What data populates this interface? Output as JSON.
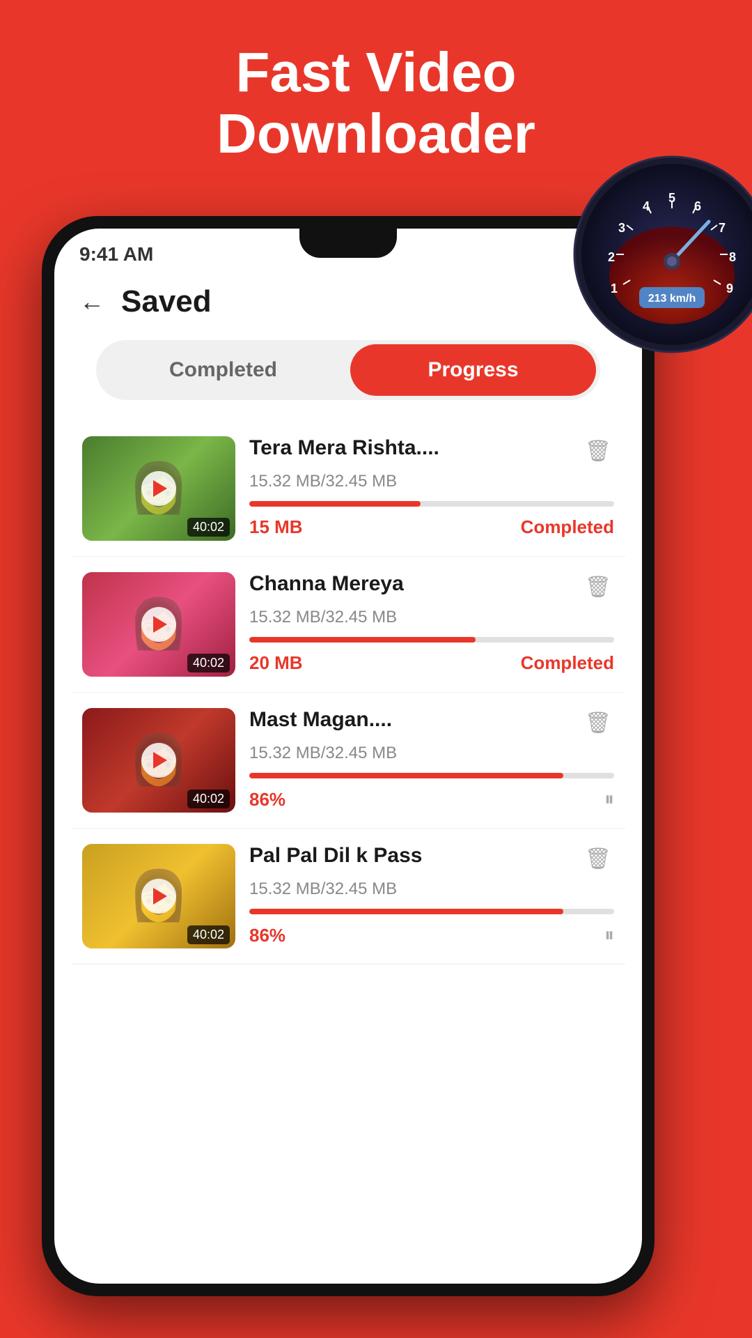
{
  "hero": {
    "title_line1": "Fast Video",
    "title_line2": "Downloader"
  },
  "status_bar": {
    "time": "9:41 AM"
  },
  "header": {
    "title": "Saved"
  },
  "tabs": [
    {
      "id": "completed",
      "label": "Completed",
      "active": false
    },
    {
      "id": "progress",
      "label": "Progress",
      "active": true
    }
  ],
  "videos": [
    {
      "id": 1,
      "title": "Tera Mera Rishta....",
      "size_info": "15.32 MB/32.45 MB",
      "downloaded": "15 MB",
      "status": "Completed",
      "progress": 47,
      "duration": "40:02",
      "thumb_color": "green",
      "show_pause": false
    },
    {
      "id": 2,
      "title": "Channa Mereya",
      "size_info": "15.32 MB/32.45 MB",
      "downloaded": "20 MB",
      "status": "Completed",
      "progress": 62,
      "duration": "40:02",
      "thumb_color": "pink",
      "show_pause": false
    },
    {
      "id": 3,
      "title": "Mast Magan....",
      "size_info": "15.32 MB/32.45 MB",
      "downloaded": "86%",
      "status": "",
      "progress": 86,
      "duration": "40:02",
      "thumb_color": "red",
      "show_pause": true
    },
    {
      "id": 4,
      "title": "Pal Pal Dil k Pass",
      "size_info": "15.32 MB/32.45 MB",
      "downloaded": "86%",
      "status": "",
      "progress": 86,
      "duration": "40:02",
      "thumb_color": "yellow",
      "show_pause": true
    }
  ],
  "speedometer": {
    "speed": "213 km/h"
  },
  "icons": {
    "back": "←",
    "delete": "🗑",
    "pause": "⏸",
    "play": "▶"
  }
}
